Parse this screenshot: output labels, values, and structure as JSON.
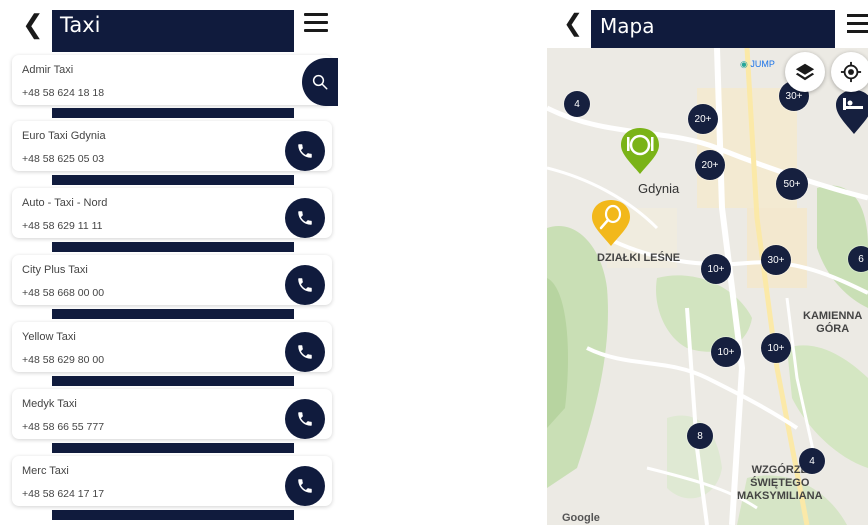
{
  "left": {
    "title": "Taxi",
    "items": [
      {
        "name": "Admir Taxi",
        "phone": "+48 58 624 18 18"
      },
      {
        "name": "Euro Taxi Gdynia",
        "phone": "+48 58 625 05 03"
      },
      {
        "name": "Auto - Taxi - Nord",
        "phone": "+48 58 629 11 11"
      },
      {
        "name": "City Plus Taxi",
        "phone": "+48 58 668 00 00"
      },
      {
        "name": "Yellow Taxi",
        "phone": "+48 58 629 80 00"
      },
      {
        "name": "Medyk Taxi",
        "phone": "+48 58 66 55 777"
      },
      {
        "name": "Merc Taxi",
        "phone": "+48 58 624 17 17"
      }
    ]
  },
  "right": {
    "title": "Mapa",
    "labels": {
      "city": "Gdynia",
      "district1": "DZIAŁKI LEŚNE",
      "district2_line1": "KAMIENNA",
      "district2_line2": "GÓRA",
      "district3_line1": "WZGÓRZE",
      "district3_line2": "ŚWIĘTEGO",
      "district3_line3": "MAKSYMILIANA",
      "poi": "JUMP",
      "google": "Google"
    },
    "clusters": [
      "4",
      "20+",
      "20+",
      "30+",
      "50+",
      "10+",
      "30+",
      "6",
      "10+",
      "10+",
      "8",
      "4"
    ]
  },
  "colors": {
    "navy": "#101b3d",
    "cluster": "#16203f",
    "green_pin": "#7ab317",
    "yellow_pin": "#f2b81b"
  }
}
